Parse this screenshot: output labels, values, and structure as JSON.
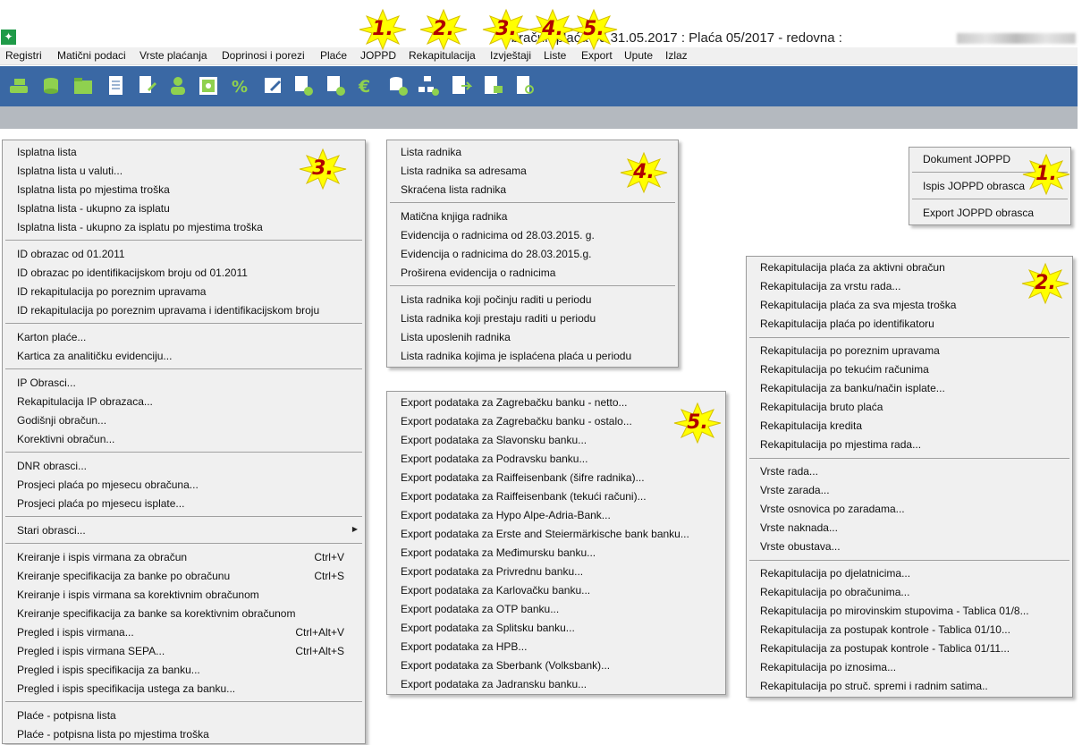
{
  "window": {
    "title": "Obračun plaća od 31.05.2017 : Plaća 05/2017 - redovna :",
    "app_icon_glyph": "✦"
  },
  "menubar": {
    "items": [
      "Registri",
      "Matični podaci",
      "Vrste plaćanja",
      "Doprinosi i porezi",
      "Plaće",
      "JOPPD",
      "Rekapitulacija",
      "Izvještaji",
      "Liste",
      "Export",
      "Upute",
      "Izlaz"
    ]
  },
  "toolbar": {
    "icons": [
      "hand-money-icon",
      "coins-icon",
      "folder-icon",
      "document-icon",
      "document-edit-icon",
      "person-icon",
      "safe-icon",
      "percent-icon",
      "form-edit-icon",
      "form-settings-icon",
      "list-settings-icon",
      "euro-icon",
      "database-settings-icon",
      "org-chart-settings-icon",
      "export-document-icon",
      "document-transfer-icon",
      "document-search-icon"
    ],
    "accent": "#3a68a4",
    "icon_color": "#8fd14f"
  },
  "badges": {
    "joppd": "1.",
    "rekapitulacija": "2.",
    "izvjestaji": "3.",
    "liste": "4.",
    "export": "5."
  },
  "joppd_menu": {
    "items": [
      "Dokument JOPPD",
      "Ispis JOPPD obrasca",
      "Export JOPPD obrasca"
    ]
  },
  "izvjestaji_menu": {
    "items": [
      {
        "label": "Isplatna lista",
        "shortcut": ""
      },
      {
        "label": "Isplatna lista u valuti...",
        "shortcut": ""
      },
      {
        "label": "Isplatna lista po mjestima troška",
        "shortcut": ""
      },
      {
        "label": "Isplatna lista - ukupno za isplatu",
        "shortcut": ""
      },
      {
        "label": "Isplatna lista - ukupno za isplatu po mjestima troška",
        "shortcut": ""
      },
      {
        "label": "ID obrazac od 01.2011",
        "shortcut": ""
      },
      {
        "label": "ID obrazac po identifikacijskom broju od 01.2011",
        "shortcut": ""
      },
      {
        "label": "ID rekapitulacija po poreznim upravama",
        "shortcut": ""
      },
      {
        "label": "ID rekapitulacija po poreznim upravama i identifikacijskom broju",
        "shortcut": ""
      },
      {
        "label": "Karton plaće...",
        "shortcut": ""
      },
      {
        "label": "Kartica za analitičku evidenciju...",
        "shortcut": ""
      },
      {
        "label": "IP Obrasci...",
        "shortcut": ""
      },
      {
        "label": "Rekapitulacija IP obrazaca...",
        "shortcut": ""
      },
      {
        "label": "Godišnji obračun...",
        "shortcut": ""
      },
      {
        "label": "Korektivni obračun...",
        "shortcut": ""
      },
      {
        "label": "DNR obrasci...",
        "shortcut": ""
      },
      {
        "label": "Prosjeci plaća po mjesecu obračuna...",
        "shortcut": ""
      },
      {
        "label": "Prosjeci plaća po mjesecu isplate...",
        "shortcut": ""
      },
      {
        "label": "Stari obrasci...",
        "shortcut": ""
      },
      {
        "label": "Kreiranje i ispis virmana za obračun",
        "shortcut": "Ctrl+V"
      },
      {
        "label": "Kreiranje specifikacija za banke po obračunu",
        "shortcut": "Ctrl+S"
      },
      {
        "label": "Kreiranje i ispis virmana sa korektivnim obračunom",
        "shortcut": ""
      },
      {
        "label": "Kreiranje specifikacija za banke sa korektivnim obračunom",
        "shortcut": ""
      },
      {
        "label": "Pregled i ispis virmana...",
        "shortcut": "Ctrl+Alt+V"
      },
      {
        "label": "Pregled i ispis virmana SEPA...",
        "shortcut": "Ctrl+Alt+S"
      },
      {
        "label": "Pregled i ispis specifikacija za banku...",
        "shortcut": ""
      },
      {
        "label": "Pregled i ispis specifikacija ustega za banku...",
        "shortcut": ""
      },
      {
        "label": "Plaće - potpisna lista",
        "shortcut": ""
      },
      {
        "label": "Plaće - potpisna lista po mjestima troška",
        "shortcut": ""
      }
    ],
    "submenu_arrow": "▶"
  },
  "liste_menu": {
    "items": [
      "Lista radnika",
      "Lista radnika sa adresama",
      "Skraćena lista radnika",
      "Matična knjiga radnika",
      "Evidencija o radnicima od 28.03.2015. g.",
      "Evidencija o radnicima do 28.03.2015.g.",
      "Proširena evidencija o radnicima",
      "Lista radnika koji počinju raditi u periodu",
      "Lista radnika koji prestaju raditi u periodu",
      "Lista uposlenih radnika",
      "Lista radnika kojima je isplaćena plaća u periodu"
    ]
  },
  "export_menu": {
    "items": [
      "Export podataka za Zagrebačku banku - netto...",
      "Export podataka za Zagrebačku banku - ostalo...",
      "Export podataka za Slavonsku banku...",
      "Export podataka za Podravsku banku...",
      "Export podataka za Raiffeisenbank (šifre radnika)...",
      "Export podataka za Raiffeisenbank (tekući računi)...",
      "Export podataka za Hypo Alpe-Adria-Bank...",
      "Export podataka za Erste and Steiermärkische bank banku...",
      "Export podataka za Međimursku banku...",
      "Export podataka za Privrednu banku...",
      "Export podataka za Karlovačku banku...",
      "Export podataka za OTP banku...",
      "Export podataka za Splitsku banku...",
      "Export podataka za HPB...",
      "Export podataka za Sberbank (Volksbank)...",
      "Export podataka za Jadransku banku..."
    ]
  },
  "rekapitulacija_menu": {
    "items": [
      "Rekapitulacija plaća za aktivni obračun",
      "Rekapitulacija za vrstu rada...",
      "Rekapitulacija plaća za sva mjesta troška",
      "Rekapitulacija plaća po identifikatoru",
      "Rekapitulacija po poreznim upravama",
      "Rekapitulacija po tekućim računima",
      "Rekapitulacija za banku/način isplate...",
      "Rekapitulacija bruto plaća",
      "Rekapitulacija kredita",
      "Rekapitulacija po mjestima rada...",
      "Vrste rada...",
      "Vrste zarada...",
      "Vrste osnovica po zaradama...",
      "Vrste naknada...",
      "Vrste obustava...",
      "Rekapitulacija po djelatnicima...",
      "Rekapitulacija po obračunima...",
      "Rekapitulacija po mirovinskim stupovima - Tablica 01/8...",
      "Rekapitulacija za postupak kontrole - Tablica 01/10...",
      "Rekapitulacija za postupak kontrole - Tablica 01/11...",
      "Rekapitulacija po iznosima...",
      "Rekapitulacija po struč. spremi i radnim satima.."
    ]
  }
}
